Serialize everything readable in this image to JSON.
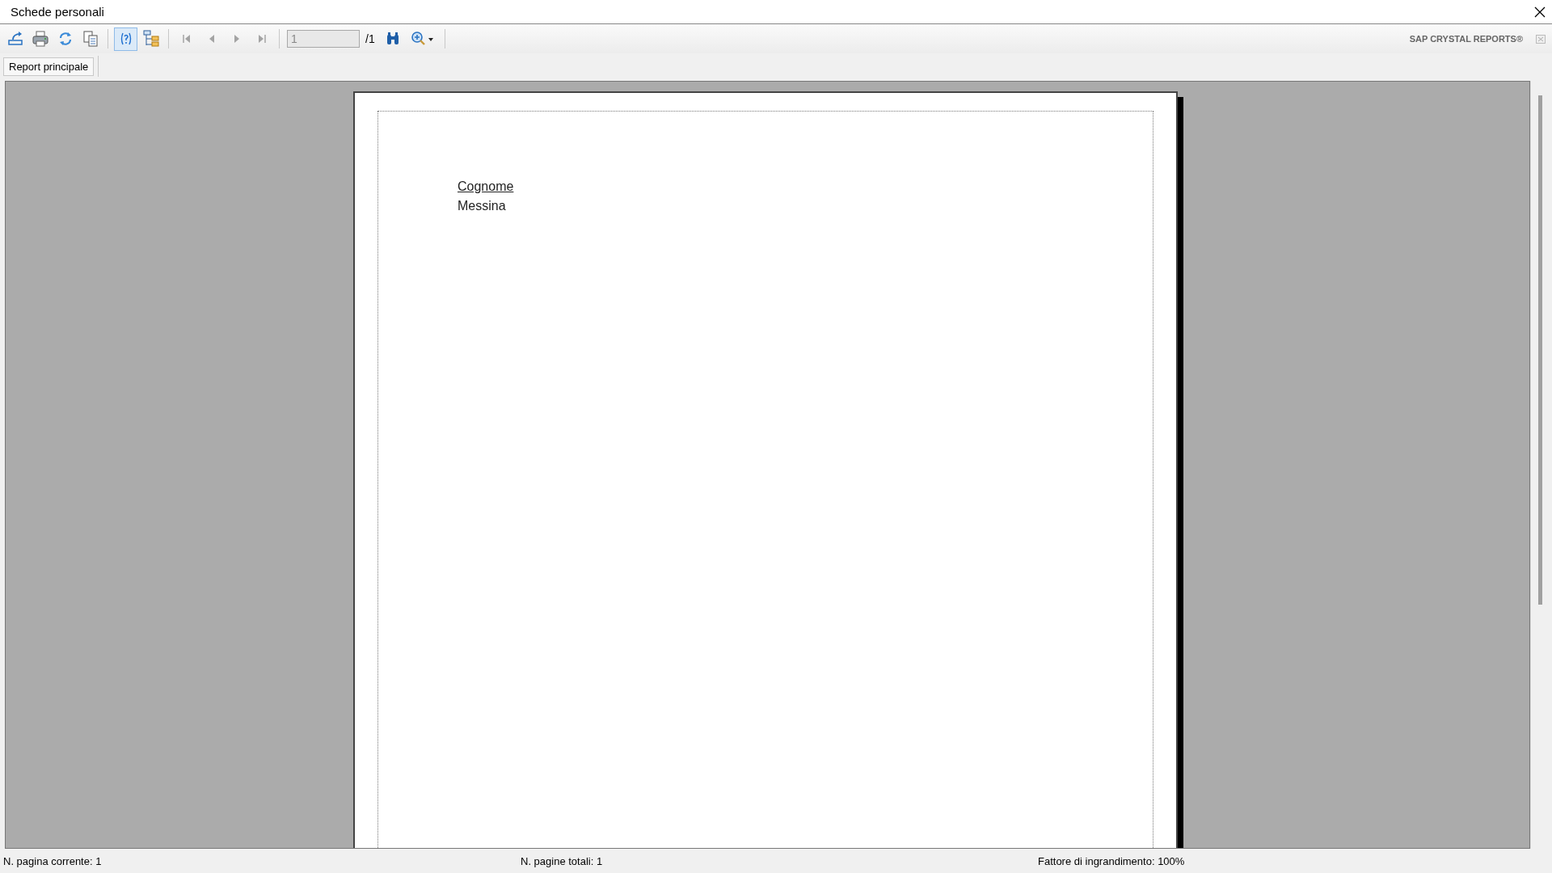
{
  "window": {
    "title": "Schede personali"
  },
  "toolbar": {
    "groups": [
      [
        {
          "kind": "export",
          "on": false,
          "disabled": false
        },
        {
          "kind": "print",
          "on": false,
          "disabled": false
        },
        {
          "kind": "refresh",
          "on": false,
          "disabled": false
        },
        {
          "kind": "copy",
          "on": false,
          "disabled": false
        }
      ],
      [
        {
          "kind": "help",
          "on": true,
          "disabled": false
        },
        {
          "kind": "tree",
          "on": false,
          "disabled": false
        }
      ],
      [
        {
          "kind": "first",
          "on": false,
          "disabled": true
        },
        {
          "kind": "prev",
          "on": false,
          "disabled": true
        },
        {
          "kind": "next",
          "on": false,
          "disabled": true
        },
        {
          "kind": "last",
          "on": false,
          "disabled": true
        }
      ]
    ],
    "page_field": {
      "value": "1",
      "disabled": true
    },
    "page_total": "/1",
    "brand": "SAP CRYSTAL REPORTS®"
  },
  "tabs": [
    {
      "label": "Report principale",
      "selected": true
    }
  ],
  "report": {
    "header": "Cognome",
    "value": "Messina"
  },
  "status_bar": [
    "N. pagina corrente: 1",
    "N. pagine totali: 1",
    "Fattore di ingrandimento: 100%"
  ]
}
